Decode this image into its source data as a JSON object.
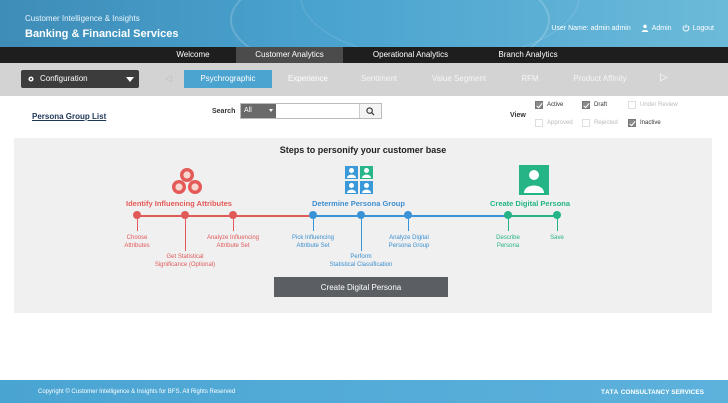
{
  "header": {
    "subtitle": "Customer Intelligence & Insights",
    "title": "Banking & Financial Services",
    "user_name": "User Name: admin admin",
    "admin_label": "Admin",
    "logout_label": "Logout"
  },
  "main_nav": {
    "tabs": [
      {
        "label": "Welcome"
      },
      {
        "label": "Customer Analytics"
      },
      {
        "label": "Operational Analytics"
      },
      {
        "label": "Branch Analytics"
      }
    ],
    "active": "Customer Analytics"
  },
  "sub_nav": {
    "configuration_label": "Configuration",
    "tabs": [
      {
        "label": "Psychrographic"
      },
      {
        "label": "Experience"
      },
      {
        "label": "Sentiment"
      },
      {
        "label": "Value Segment"
      },
      {
        "label": "RFM"
      },
      {
        "label": "Product Affinity"
      }
    ],
    "active": "Psychrographic"
  },
  "toolbar": {
    "persona_group_list": "Persona Group List",
    "search_label": "Search",
    "search_select_value": "All",
    "search_value": "",
    "view_label": "View",
    "view_options": [
      {
        "label": "Active",
        "checked": true
      },
      {
        "label": "Draft",
        "checked": true
      },
      {
        "label": "Under Review",
        "checked": false
      },
      {
        "label": "Approved",
        "checked": false
      },
      {
        "label": "Rejected",
        "checked": false
      },
      {
        "label": "Inactive",
        "checked": true
      }
    ]
  },
  "steps": {
    "title": "Steps to personify your customer base",
    "stages": [
      {
        "title": "Identify Influencing Attributes"
      },
      {
        "title": "Determine Persona Group"
      },
      {
        "title": "Create Digital Persona"
      }
    ],
    "items": [
      {
        "line1": "Choose",
        "line2": "Attributes"
      },
      {
        "line1": "Get Statistical",
        "line2": "Significance (Optional)"
      },
      {
        "line1": "Analyze Influencing",
        "line2": "Attribute Set"
      },
      {
        "line1": "Pick Influencing",
        "line2": "Attribute Set"
      },
      {
        "line1": "Perform",
        "line2": "Statistical Classification"
      },
      {
        "line1": "Analyze Digital",
        "line2": "Persona Group"
      },
      {
        "line1": "Describe",
        "line2": "Persona"
      },
      {
        "line1": "Save",
        "line2": ""
      }
    ],
    "button_label": "Create Digital Persona",
    "colors": {
      "red": "#e05a5a",
      "blue": "#3a93d6",
      "green": "#23b386"
    }
  },
  "footer": {
    "copyright": "Copyright © Customer Intelligence & Insights for BFS. All Rights Reserved",
    "brand_bold": "TATA",
    "brand_rest": "CONSULTANCY SERVICES"
  }
}
